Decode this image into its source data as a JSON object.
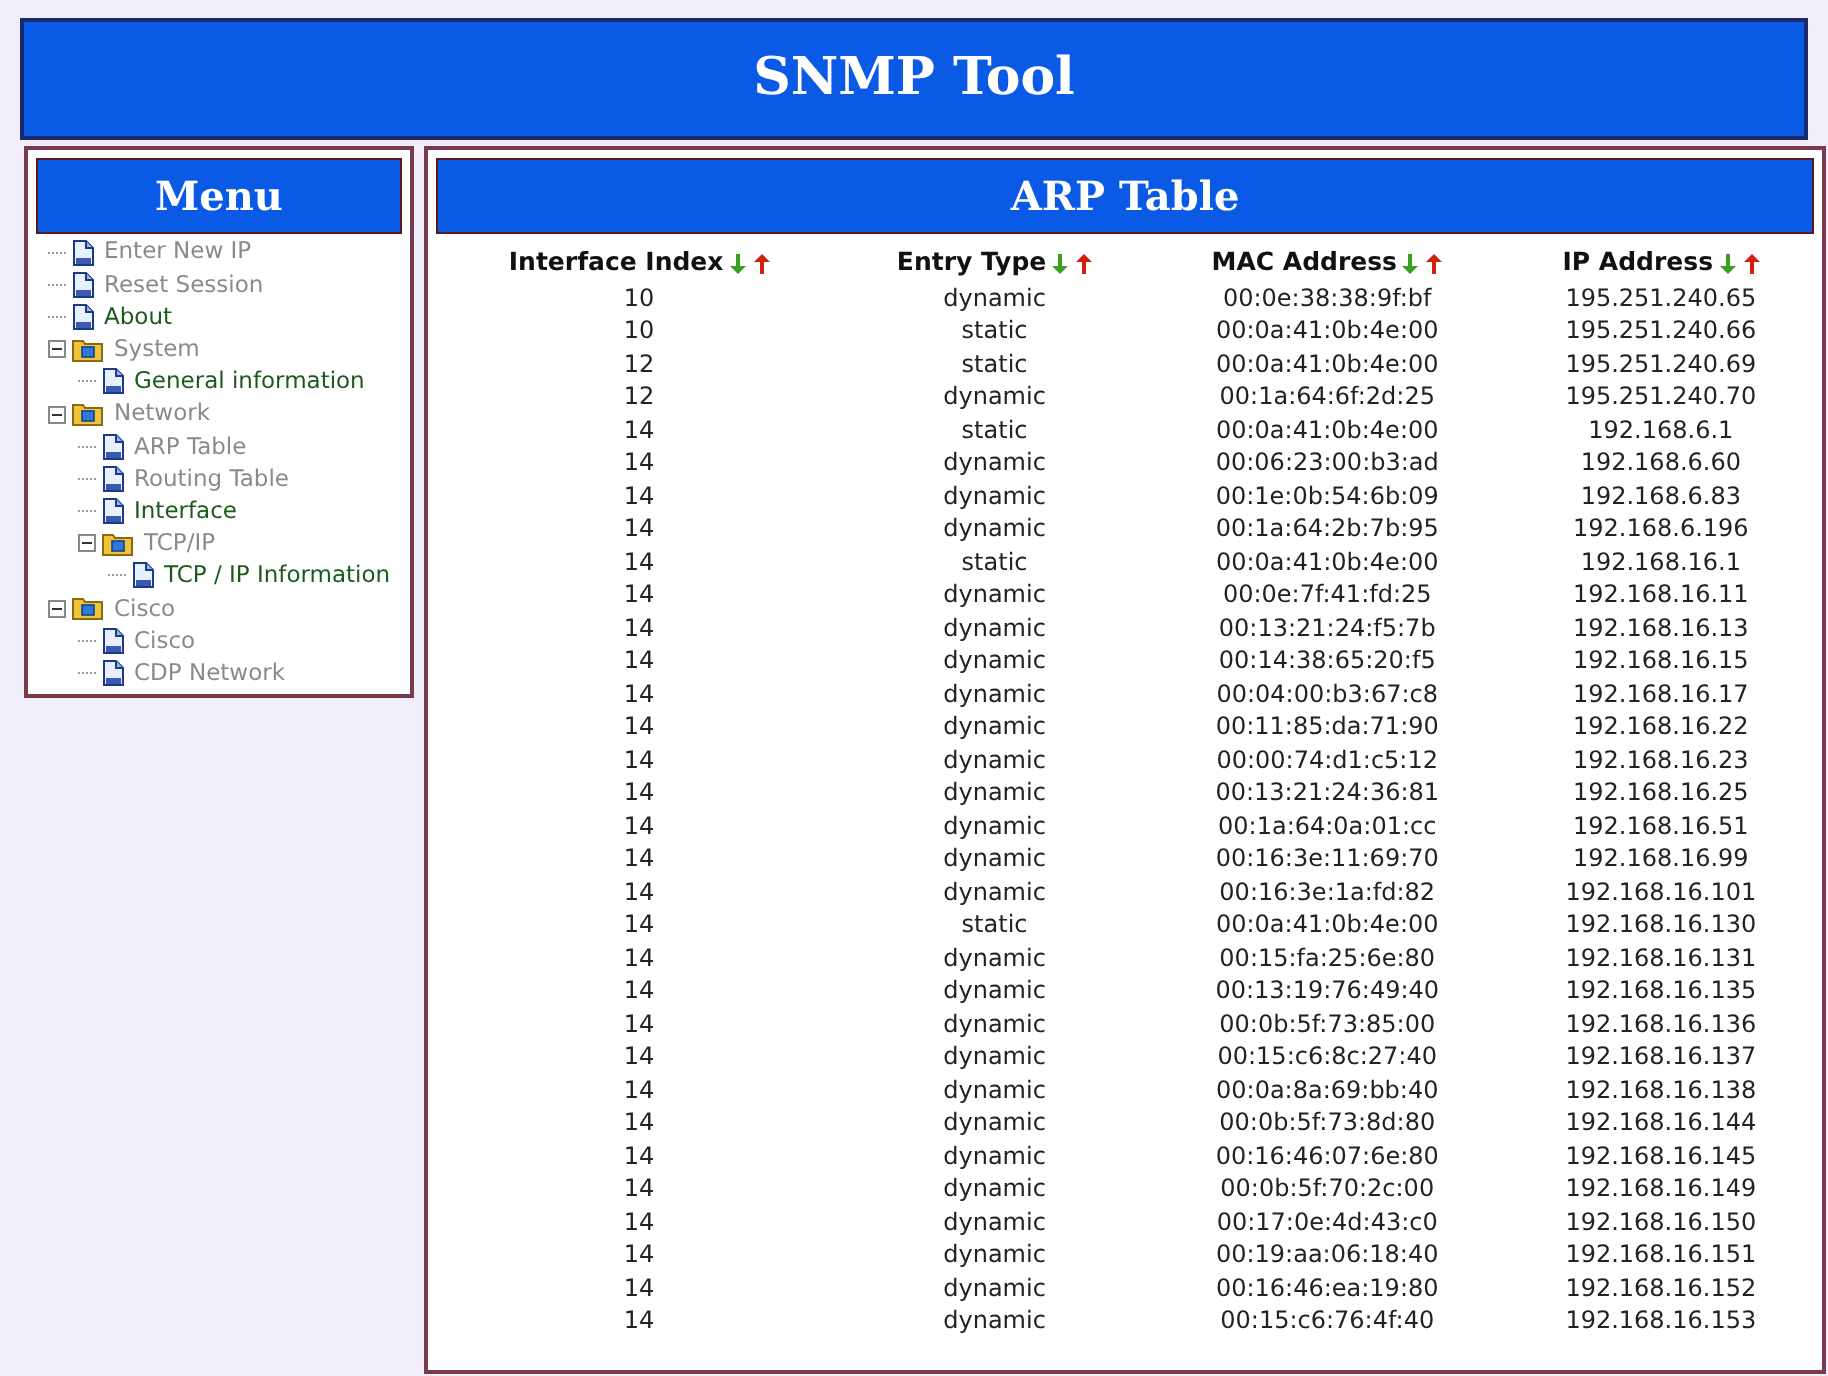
{
  "header": {
    "title": "SNMP Tool"
  },
  "menu": {
    "title": "Menu",
    "items": [
      {
        "kind": "page",
        "label": "Enter New IP",
        "visited": true
      },
      {
        "kind": "page",
        "label": "Reset Session",
        "visited": true
      },
      {
        "kind": "page",
        "label": "About",
        "visited": false
      },
      {
        "kind": "folder",
        "label": "System",
        "visited": true,
        "expanded": true,
        "children": [
          {
            "kind": "page",
            "label": "General information",
            "visited": false
          }
        ]
      },
      {
        "kind": "folder",
        "label": "Network",
        "visited": true,
        "expanded": true,
        "children": [
          {
            "kind": "page",
            "label": "ARP Table",
            "visited": true
          },
          {
            "kind": "page",
            "label": "Routing Table",
            "visited": true
          },
          {
            "kind": "page",
            "label": "Interface",
            "visited": false
          },
          {
            "kind": "folder",
            "label": "TCP/IP",
            "visited": true,
            "expanded": true,
            "children": [
              {
                "kind": "page",
                "label": "TCP / IP Information",
                "visited": false
              }
            ]
          }
        ]
      },
      {
        "kind": "folder",
        "label": "Cisco",
        "visited": true,
        "expanded": true,
        "children": [
          {
            "kind": "page",
            "label": "Cisco",
            "visited": true
          },
          {
            "kind": "page",
            "label": "CDP Network",
            "visited": true
          }
        ]
      }
    ]
  },
  "arp_table": {
    "title": "ARP Table",
    "columns": [
      {
        "label": "Interface Index"
      },
      {
        "label": "Entry Type"
      },
      {
        "label": "MAC Address"
      },
      {
        "label": "IP Address"
      }
    ],
    "rows": [
      [
        "10",
        "dynamic",
        "00:0e:38:38:9f:bf",
        "195.251.240.65"
      ],
      [
        "10",
        "static",
        "00:0a:41:0b:4e:00",
        "195.251.240.66"
      ],
      [
        "12",
        "static",
        "00:0a:41:0b:4e:00",
        "195.251.240.69"
      ],
      [
        "12",
        "dynamic",
        "00:1a:64:6f:2d:25",
        "195.251.240.70"
      ],
      [
        "14",
        "static",
        "00:0a:41:0b:4e:00",
        "192.168.6.1"
      ],
      [
        "14",
        "dynamic",
        "00:06:23:00:b3:ad",
        "192.168.6.60"
      ],
      [
        "14",
        "dynamic",
        "00:1e:0b:54:6b:09",
        "192.168.6.83"
      ],
      [
        "14",
        "dynamic",
        "00:1a:64:2b:7b:95",
        "192.168.6.196"
      ],
      [
        "14",
        "static",
        "00:0a:41:0b:4e:00",
        "192.168.16.1"
      ],
      [
        "14",
        "dynamic",
        "00:0e:7f:41:fd:25",
        "192.168.16.11"
      ],
      [
        "14",
        "dynamic",
        "00:13:21:24:f5:7b",
        "192.168.16.13"
      ],
      [
        "14",
        "dynamic",
        "00:14:38:65:20:f5",
        "192.168.16.15"
      ],
      [
        "14",
        "dynamic",
        "00:04:00:b3:67:c8",
        "192.168.16.17"
      ],
      [
        "14",
        "dynamic",
        "00:11:85:da:71:90",
        "192.168.16.22"
      ],
      [
        "14",
        "dynamic",
        "00:00:74:d1:c5:12",
        "192.168.16.23"
      ],
      [
        "14",
        "dynamic",
        "00:13:21:24:36:81",
        "192.168.16.25"
      ],
      [
        "14",
        "dynamic",
        "00:1a:64:0a:01:cc",
        "192.168.16.51"
      ],
      [
        "14",
        "dynamic",
        "00:16:3e:11:69:70",
        "192.168.16.99"
      ],
      [
        "14",
        "dynamic",
        "00:16:3e:1a:fd:82",
        "192.168.16.101"
      ],
      [
        "14",
        "static",
        "00:0a:41:0b:4e:00",
        "192.168.16.130"
      ],
      [
        "14",
        "dynamic",
        "00:15:fa:25:6e:80",
        "192.168.16.131"
      ],
      [
        "14",
        "dynamic",
        "00:13:19:76:49:40",
        "192.168.16.135"
      ],
      [
        "14",
        "dynamic",
        "00:0b:5f:73:85:00",
        "192.168.16.136"
      ],
      [
        "14",
        "dynamic",
        "00:15:c6:8c:27:40",
        "192.168.16.137"
      ],
      [
        "14",
        "dynamic",
        "00:0a:8a:69:bb:40",
        "192.168.16.138"
      ],
      [
        "14",
        "dynamic",
        "00:0b:5f:73:8d:80",
        "192.168.16.144"
      ],
      [
        "14",
        "dynamic",
        "00:16:46:07:6e:80",
        "192.168.16.145"
      ],
      [
        "14",
        "dynamic",
        "00:0b:5f:70:2c:00",
        "192.168.16.149"
      ],
      [
        "14",
        "dynamic",
        "00:17:0e:4d:43:c0",
        "192.168.16.150"
      ],
      [
        "14",
        "dynamic",
        "00:19:aa:06:18:40",
        "192.168.16.151"
      ],
      [
        "14",
        "dynamic",
        "00:16:46:ea:19:80",
        "192.168.16.152"
      ],
      [
        "14",
        "dynamic",
        "00:15:c6:76:4f:40",
        "192.168.16.153"
      ]
    ]
  }
}
